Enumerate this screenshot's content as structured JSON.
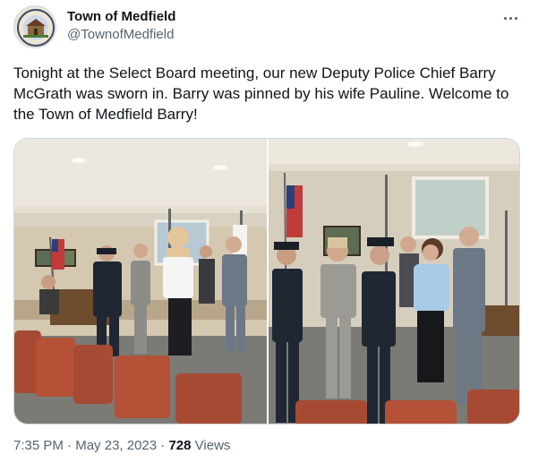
{
  "account": {
    "name": "Town of Medfield",
    "handle": "@TownofMedfield",
    "avatar_icon": "town-seal-icon"
  },
  "more_icon": "more-dots-icon",
  "tweet": {
    "text": "Tonight at the Select Board meeting, our new Deputy Police Chief Barry McGrath was sworn in.  Barry was pinned by his wife Pauline. Welcome to the Town of Medfield Barry!"
  },
  "media": [
    {
      "name": "swearing-in-photo"
    },
    {
      "name": "pinning-photo"
    }
  ],
  "meta": {
    "time": "7:35 PM",
    "separator": "·",
    "date": "May 23, 2023",
    "views_count": "728",
    "views_label": "Views"
  },
  "colors": {
    "text_primary": "#0f1419",
    "text_secondary": "#536471",
    "border": "#cfd9de"
  }
}
